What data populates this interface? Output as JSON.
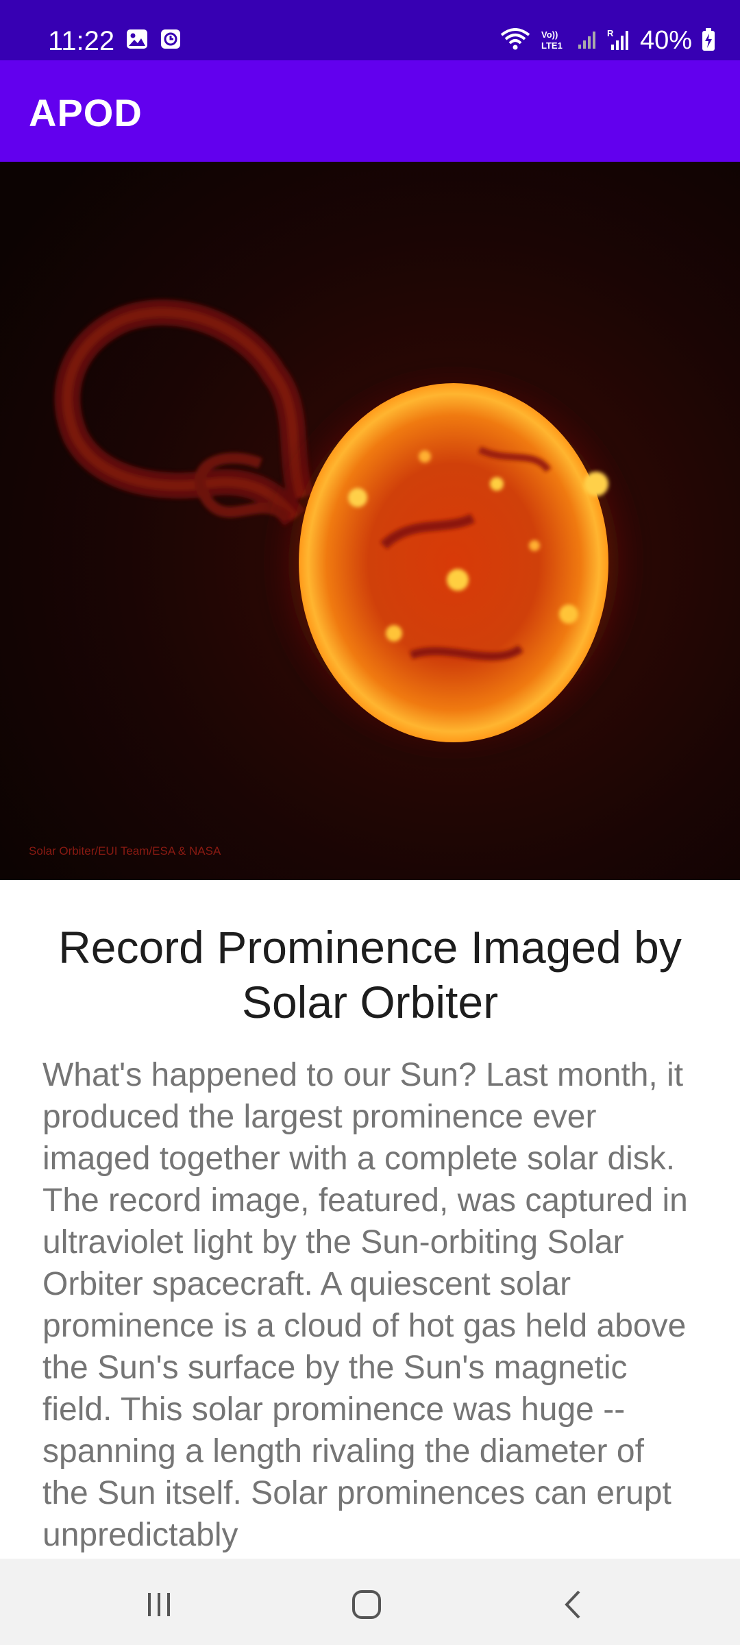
{
  "status_bar": {
    "time": "11:22",
    "battery": "40%",
    "icons": [
      "gallery-icon",
      "clock-icon",
      "wifi-icon",
      "volte-lte-icon",
      "signal-icon",
      "roaming-signal-icon",
      "battery-charging-icon"
    ]
  },
  "app_bar": {
    "title": "APOD"
  },
  "hero": {
    "image_name": "sun-prominence-image",
    "credit": "Solar Orbiter/EUI Team/ESA & NASA"
  },
  "article": {
    "title": "Record Prominence Imaged by Solar Orbiter",
    "explanation": "What's happened to our Sun?  Last month, it produced the largest prominence ever imaged together with a complete solar disk. The record image, featured, was captured in ultraviolet light by the Sun-orbiting Solar Orbiter spacecraft. A quiescent solar prominence is a cloud of hot gas held above the Sun's surface by the Sun's magnetic field.  This solar prominence was huge -- spanning a length rivaling the diameter of the Sun itself. Solar prominences can erupt unpredictably"
  },
  "nav_bar": {
    "buttons": [
      "recent-apps-button",
      "home-button",
      "back-button"
    ]
  },
  "colors": {
    "status_bar": "#3700b3",
    "app_bar": "#6200ee",
    "title_text": "#1d1d1d",
    "body_text": "#757575",
    "nav_bar": "#f2f2f2"
  }
}
